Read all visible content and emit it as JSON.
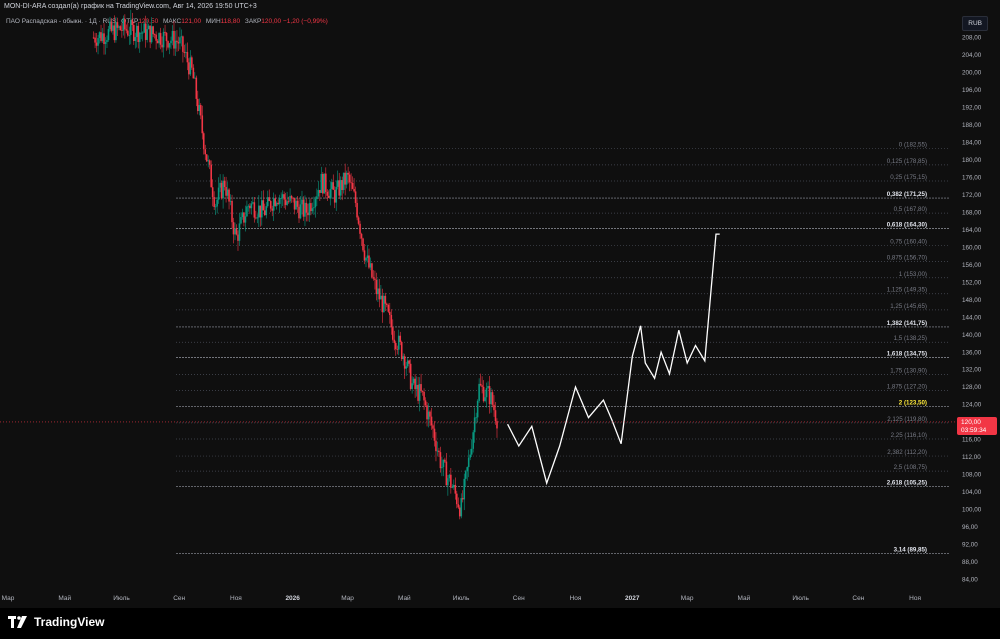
{
  "header": {
    "title": "MON-DI-ARA создал(а) график на TradingView.com, Авг 14, 2026 19:50 UTC+3"
  },
  "symbol": {
    "name": "ПАО Распадская - обыкн. · 1Д · RUS",
    "open_label": "ОТКР",
    "open": "120,50",
    "high_label": "МАКС",
    "high": "121,00",
    "low_label": "МИН",
    "low": "118,80",
    "close_label": "ЗАКР",
    "close": "120,00",
    "change": "−1,20 (−0,99%)"
  },
  "currency_button": "RUB",
  "price_tag": {
    "price": "120,00",
    "countdown": "03:59:34"
  },
  "footer": {
    "brand": "TradingView"
  },
  "colors": {
    "up": "#089981",
    "down": "#f23645",
    "projection": "#ffffff",
    "fib_line": "#787b86",
    "fib_highlight": "#ffeb3b",
    "background": "#0f0f0f"
  },
  "chart_data": {
    "type": "line",
    "y_axis": {
      "min": 82,
      "max": 212,
      "ticks": [
        "208,00",
        "204,00",
        "200,00",
        "196,00",
        "192,00",
        "188,00",
        "184,00",
        "180,00",
        "176,00",
        "172,00",
        "168,00",
        "164,00",
        "160,00",
        "156,00",
        "152,00",
        "148,00",
        "144,00",
        "140,00",
        "136,00",
        "132,00",
        "128,00",
        "124,00",
        "120,00",
        "116,00",
        "112,00",
        "108,00",
        "104,00",
        "100,00",
        "96,00",
        "92,00",
        "88,00",
        "84,00"
      ],
      "tick_values": [
        208,
        204,
        200,
        196,
        192,
        188,
        184,
        180,
        176,
        172,
        168,
        164,
        160,
        156,
        152,
        148,
        144,
        140,
        136,
        132,
        128,
        124,
        120,
        116,
        112,
        108,
        104,
        100,
        96,
        92,
        88,
        84
      ]
    },
    "x_axis": {
      "ticks": [
        "Мар",
        "Май",
        "Июль",
        "Сен",
        "Ноя",
        "2026",
        "Мар",
        "Май",
        "Июль",
        "Сен",
        "Ноя",
        "2027",
        "Мар",
        "Май",
        "Июль",
        "Сен",
        "Ноя"
      ],
      "tick_dates": [
        "2025-03",
        "2025-05",
        "2025-07",
        "2025-09",
        "2025-11",
        "2026-01",
        "2026-03",
        "2026-05",
        "2026-07",
        "2026-09",
        "2026-11",
        "2027-01",
        "2027-03",
        "2027-05",
        "2027-07",
        "2027-09",
        "2027-11"
      ],
      "bold": [
        "2026",
        "2027"
      ]
    },
    "price_series": {
      "name": "",
      "x": [
        "2025-06",
        "2025-07",
        "2025-08",
        "2025-09",
        "2025-09-15",
        "2025-10",
        "2025-10-10",
        "2025-10-20",
        "2025-11",
        "2025-11-15",
        "2025-12",
        "2025-12-15",
        "2026-01",
        "2026-01-15",
        "2026-02",
        "2026-02-15",
        "2026-03",
        "2026-03-10",
        "2026-03-20",
        "2026-04",
        "2026-04-10",
        "2026-04-20",
        "2026-05",
        "2026-05-10",
        "2026-05-20",
        "2026-06",
        "2026-06-10",
        "2026-06-20",
        "2026-07",
        "2026-07-10",
        "2026-07-20",
        "2026-08",
        "2026-08-10"
      ],
      "close": [
        208,
        210,
        209,
        207,
        200,
        180,
        170,
        175,
        162,
        170,
        168,
        172,
        170,
        168,
        175,
        172,
        176,
        170,
        158,
        150,
        146,
        140,
        135,
        128,
        126,
        118,
        110,
        106,
        100,
        112,
        128,
        126,
        120
      ]
    },
    "projection_series": {
      "name": "",
      "x": [
        "2026-08-20",
        "2026-09-01",
        "2026-09-15",
        "2026-10-01",
        "2026-10-15",
        "2026-11-01",
        "2026-11-15",
        "2026-12-01",
        "2026-12-10",
        "2026-12-20",
        "2027-01-01",
        "2027-01-10",
        "2027-01-15",
        "2027-01-25",
        "2027-02-01",
        "2027-02-10",
        "2027-02-20",
        "2027-03-01",
        "2027-03-10",
        "2027-03-20",
        "2027-04-01",
        "2027-04-05"
      ],
      "y": [
        119.5,
        114.5,
        119.0,
        106.0,
        114.5,
        128.0,
        121.0,
        125.0,
        120.5,
        115.0,
        135.0,
        142.0,
        133.5,
        130.0,
        136.0,
        131.0,
        141.0,
        133.5,
        137.5,
        134.0,
        163.0,
        163.0
      ]
    },
    "fib_levels": [
      {
        "ratio": "0",
        "price": 182.55,
        "label": "0 (182,55)",
        "bold": false
      },
      {
        "ratio": "0,125",
        "price": 178.85,
        "label": "0,125 (178,85)",
        "bold": false
      },
      {
        "ratio": "0,25",
        "price": 175.15,
        "label": "0,25 (175,15)",
        "bold": false
      },
      {
        "ratio": "0,382",
        "price": 171.25,
        "label": "0,382 (171,25)",
        "bold": true
      },
      {
        "ratio": "0,5",
        "price": 167.8,
        "label": "0,5 (167,80)",
        "bold": false
      },
      {
        "ratio": "0,618",
        "price": 164.3,
        "label": "0,618 (164,30)",
        "bold": true
      },
      {
        "ratio": "0,75",
        "price": 160.4,
        "label": "0,75 (160,40)",
        "bold": false
      },
      {
        "ratio": "0,875",
        "price": 156.7,
        "label": "0,875 (156,70)",
        "bold": false
      },
      {
        "ratio": "1",
        "price": 153.0,
        "label": "1 (153,00)",
        "bold": false
      },
      {
        "ratio": "1,125",
        "price": 149.35,
        "label": "1,125 (149,35)",
        "bold": false
      },
      {
        "ratio": "1,25",
        "price": 145.65,
        "label": "1,25 (145,65)",
        "bold": false
      },
      {
        "ratio": "1,382",
        "price": 141.75,
        "label": "1,382 (141,75)",
        "bold": true
      },
      {
        "ratio": "1,5",
        "price": 138.25,
        "label": "1,5 (138,25)",
        "bold": false
      },
      {
        "ratio": "1,618",
        "price": 134.75,
        "label": "1,618 (134,75)",
        "bold": true
      },
      {
        "ratio": "1,75",
        "price": 130.9,
        "label": "1,75 (130,90)",
        "bold": false
      },
      {
        "ratio": "1,875",
        "price": 127.2,
        "label": "1,875 (127,20)",
        "bold": false
      },
      {
        "ratio": "2",
        "price": 123.5,
        "label": "2 (123,50)",
        "bold": true,
        "highlight": true
      },
      {
        "ratio": "2,125",
        "price": 119.8,
        "label": "2,125 (119,80)",
        "bold": false
      },
      {
        "ratio": "2,25",
        "price": 116.1,
        "label": "2,25 (116,10)",
        "bold": false
      },
      {
        "ratio": "2,382",
        "price": 112.2,
        "label": "2,382 (112,20)",
        "bold": false
      },
      {
        "ratio": "2,5",
        "price": 108.75,
        "label": "2,5 (108,75)",
        "bold": false
      },
      {
        "ratio": "2,618",
        "price": 105.25,
        "label": "2,618 (105,25)",
        "bold": true
      },
      {
        "ratio": "3,14",
        "price": 89.85,
        "label": "3,14 (89,85)",
        "bold": true
      }
    ],
    "last_price": 120.0,
    "grid": false,
    "legend": "none"
  }
}
